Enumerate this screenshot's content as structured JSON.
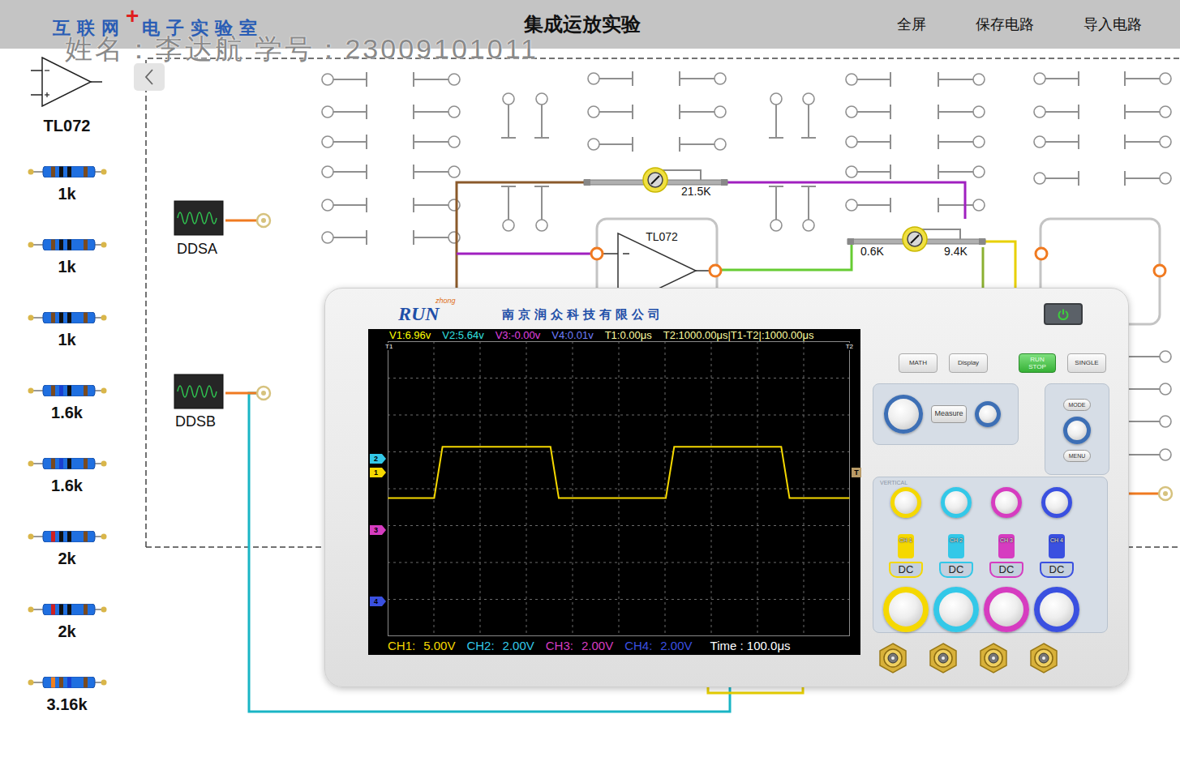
{
  "header": {
    "logo_main": "互联网",
    "logo_plus": "+",
    "logo_sub": "电子实验室",
    "title": "集成运放实验",
    "links": [
      "全屏",
      "保存电路",
      "导入电路"
    ]
  },
  "watermark": "姓名：李达航 学号：23009101011",
  "sidebar": {
    "items": [
      {
        "label": "TL072",
        "kind": "opamp"
      },
      {
        "label": "1k",
        "kind": "resistor",
        "bands": [
          "#7a4a1e",
          "#111111",
          "#111111",
          "#7a4a1e"
        ]
      },
      {
        "label": "1k",
        "kind": "resistor",
        "bands": [
          "#7a4a1e",
          "#111111",
          "#111111",
          "#7a4a1e"
        ]
      },
      {
        "label": "1k",
        "kind": "resistor",
        "bands": [
          "#7a4a1e",
          "#111111",
          "#111111",
          "#7a4a1e"
        ]
      },
      {
        "label": "1.6k",
        "kind": "resistor",
        "bands": [
          "#7a4a1e",
          "#1a3fd0",
          "#111111",
          "#7a4a1e"
        ]
      },
      {
        "label": "1.6k",
        "kind": "resistor",
        "bands": [
          "#7a4a1e",
          "#1a3fd0",
          "#111111",
          "#7a4a1e"
        ]
      },
      {
        "label": "2k",
        "kind": "resistor",
        "bands": [
          "#d02020",
          "#111111",
          "#111111",
          "#7a4a1e"
        ]
      },
      {
        "label": "2k",
        "kind": "resistor",
        "bands": [
          "#d02020",
          "#111111",
          "#111111",
          "#7a4a1e"
        ]
      },
      {
        "label": "3.16k",
        "kind": "resistor",
        "bands": [
          "#f08020",
          "#7a4a1e",
          "#1a3fd0",
          "#7a4a1e"
        ]
      }
    ]
  },
  "circuit": {
    "sources": [
      {
        "label": "DDSA"
      },
      {
        "label": "DDSB"
      }
    ],
    "opamp": {
      "label": "TL072"
    },
    "pots": [
      {
        "labels": [
          "21.5K"
        ]
      },
      {
        "labels": [
          "0.6K",
          "9.4K"
        ]
      }
    ]
  },
  "scope": {
    "brand": "RUN",
    "brand_sub": "zhong",
    "company": "南京润众科技有限公司",
    "readings": [
      {
        "text": "V1:6.96v",
        "color": "#ffff00"
      },
      {
        "text": "V2:5.64v",
        "color": "#33e0e0"
      },
      {
        "text": "V3:-0.00v",
        "color": "#e040e0"
      },
      {
        "text": "V4:0.01v",
        "color": "#6f7fff"
      },
      {
        "text": "T1:0.00μs",
        "color": "#ffffa0"
      },
      {
        "text": "T2:1000.00μs|T1-T2|:1000.00μs",
        "color": "#ffffa0"
      }
    ],
    "cursors": [
      {
        "label": "T1"
      },
      {
        "label": "T2"
      }
    ],
    "trigger": {
      "label": "T",
      "offset_div": 0.44
    },
    "channels": [
      {
        "name": "CH1:",
        "scale": "5.00V",
        "badge": "CH 1",
        "coupling": "DC",
        "marker": "1",
        "offset_div": 0.44,
        "color": "#f5d800"
      },
      {
        "name": "CH2:",
        "scale": "2.00V",
        "badge": "CH 2",
        "coupling": "DC",
        "marker": "2",
        "offset_div": 0.81,
        "color": "#33c8e8"
      },
      {
        "name": "CH3:",
        "scale": "2.00V",
        "badge": "CH 3",
        "coupling": "DC",
        "marker": "3",
        "offset_div": -1.12,
        "color": "#d63cc0"
      },
      {
        "name": "CH4:",
        "scale": "2.00V",
        "badge": "CH 4",
        "coupling": "DC",
        "marker": "4",
        "offset_div": -3.05,
        "color": "#3a50e0"
      }
    ],
    "time": "Time : 100.0μs",
    "trace": {
      "channel": 0,
      "volts_per_div": 5,
      "time_span_us": 1000,
      "times_us": [
        0,
        100,
        118,
        352,
        370,
        602,
        620,
        852,
        870,
        1000
      ],
      "values_v": [
        -3.48,
        -3.48,
        3.48,
        3.48,
        -3.48,
        -3.48,
        3.48,
        3.48,
        -3.48,
        -3.48
      ]
    },
    "buttons": [
      {
        "label": "MATH",
        "kind": "plain"
      },
      {
        "label": "Display",
        "kind": "plain"
      },
      {
        "label": "RUN STOP",
        "kind": "run"
      },
      {
        "label": "SINGLE",
        "kind": "plain"
      }
    ],
    "measure": "Measure",
    "mode": "MODE",
    "menu": "MENU",
    "vertical_title": "VERTICAL"
  }
}
